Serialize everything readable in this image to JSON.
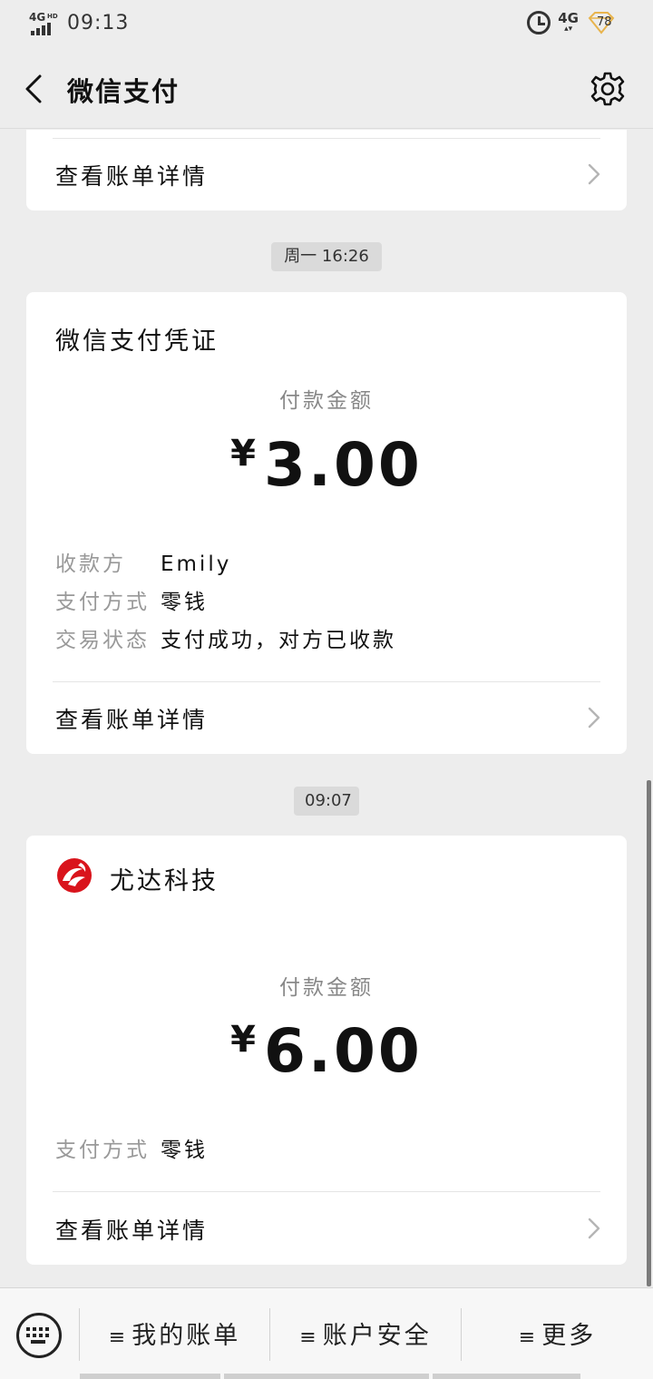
{
  "status": {
    "network": "4G",
    "network_hd": "HD",
    "time": "09:13",
    "mobile_data": "4G",
    "battery": "78"
  },
  "nav": {
    "title": "微信支付"
  },
  "cards": [
    {
      "detail_label": "查看账单详情"
    },
    {
      "time": "周一 16:26",
      "title": "微信支付凭证",
      "amount_label": "付款金额",
      "currency": "¥",
      "amount": "3.00",
      "rows": [
        {
          "key": "收款方",
          "value": "Emily"
        },
        {
          "key": "支付方式",
          "value": "零钱"
        },
        {
          "key": "交易状态",
          "value": "支付成功，对方已收款"
        }
      ],
      "detail_label": "查看账单详情"
    },
    {
      "time": "09:07",
      "merchant": "尤达科技",
      "amount_label": "付款金额",
      "currency": "¥",
      "amount": "6.00",
      "rows": [
        {
          "key": "支付方式",
          "value": "零钱"
        }
      ],
      "detail_label": "查看账单详情"
    }
  ],
  "bottom_menu": {
    "items": [
      {
        "icon": "≡",
        "label": "我的账单"
      },
      {
        "icon": "≡",
        "label": "账户安全"
      },
      {
        "icon": "≡",
        "label": "更多"
      }
    ]
  },
  "colors": {
    "background": "#ededed",
    "card": "#ffffff",
    "logo_red": "#d9141c"
  }
}
